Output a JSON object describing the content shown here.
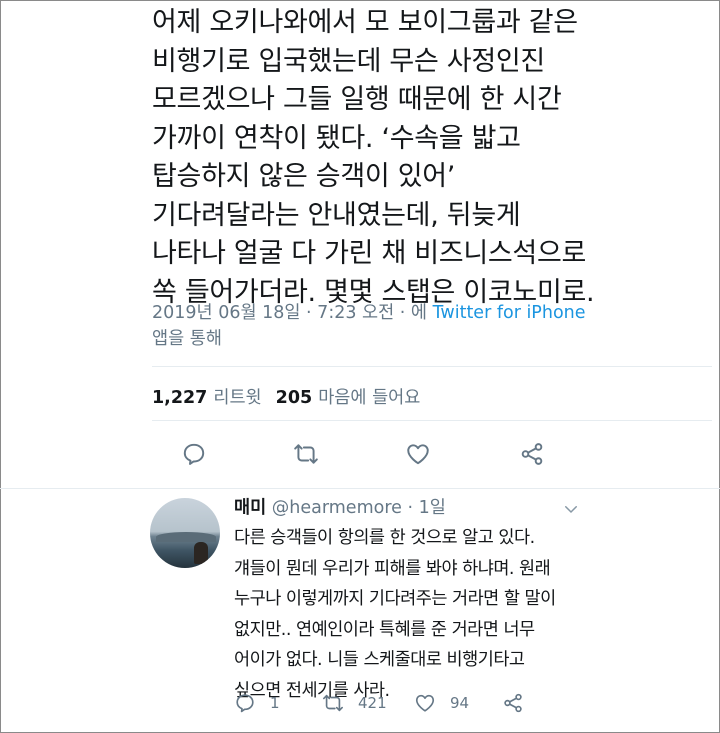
{
  "tweet": {
    "text": "어제 오키나와에서 모 보이그룹과 같은\n비행기로 입국했는데 무슨 사정인진\n모르겠으나 그들 일행 때문에 한 시간\n가까이 연착이 됐다. ‘수속을 밟고\n탑승하지 않은 승객이 있어’\n기다려달라는 안내였는데, 뒤늦게\n나타나 얼굴 다 가린 채 비즈니스석으로\n쏙 들어가더라. 몇몇 스탭은 이코노미로.",
    "timestamp": "2019년 06월 18일 · 7:23 오전 · 에 ",
    "source": "Twitter for iPhone",
    "source_suffix": "앱을 통해",
    "retweet_count": "1,227",
    "retweet_label": "리트윗",
    "like_count": "205",
    "like_label": "마음에 들어요",
    "actions": [
      "reply-icon",
      "retweet-icon",
      "like-icon",
      "share-icon"
    ]
  },
  "reply": {
    "name": "매미",
    "handle": "@hearmemore · 1일",
    "text": "다른 승객들이 항의를 한 것으로 알고 있다.\n걔들이 뭔데 우리가 피해를 봐야 하냐며. 원래\n누구나 이렇게까지 기다려주는 거라면 할 말이\n없지만.. 연예인이라 특혜를 준 거라면 너무\n어이가 없다. 니들 스케줄대로 비행기타고\n싶으면 전세기를 사라.",
    "reply_count": "1",
    "retweet_count": "421",
    "like_count": "94"
  },
  "colors": {
    "text": "#14171a",
    "secondary": "#657786",
    "link": "#1b95e0",
    "divider": "#e6ecf0"
  }
}
